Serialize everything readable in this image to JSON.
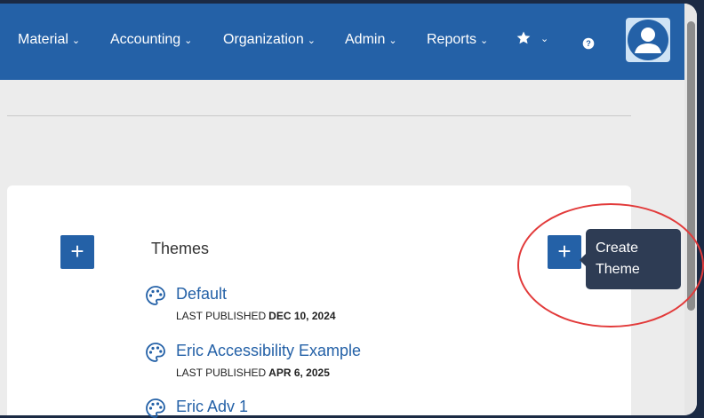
{
  "nav": {
    "items": [
      {
        "label": "Material"
      },
      {
        "label": "Accounting"
      },
      {
        "label": "Organization"
      },
      {
        "label": "Admin"
      },
      {
        "label": "Reports"
      }
    ],
    "favorites_icon": "star-icon",
    "help_icon": "help-icon",
    "avatar_icon": "user-avatar-icon"
  },
  "themes": {
    "title": "Themes",
    "published_prefix": "LAST PUBLISHED",
    "items": [
      {
        "name": "Default",
        "date": "DEC 10, 2024"
      },
      {
        "name": "Eric Accessibility Example",
        "date": "APR 6, 2025"
      },
      {
        "name": "Eric Adv 1"
      }
    ]
  },
  "tooltip": {
    "text": "Create Theme"
  },
  "colors": {
    "nav_bg": "#2461a7",
    "link": "#2461a7",
    "tooltip_bg": "#2e3c54",
    "highlight": "#e23a3a"
  }
}
